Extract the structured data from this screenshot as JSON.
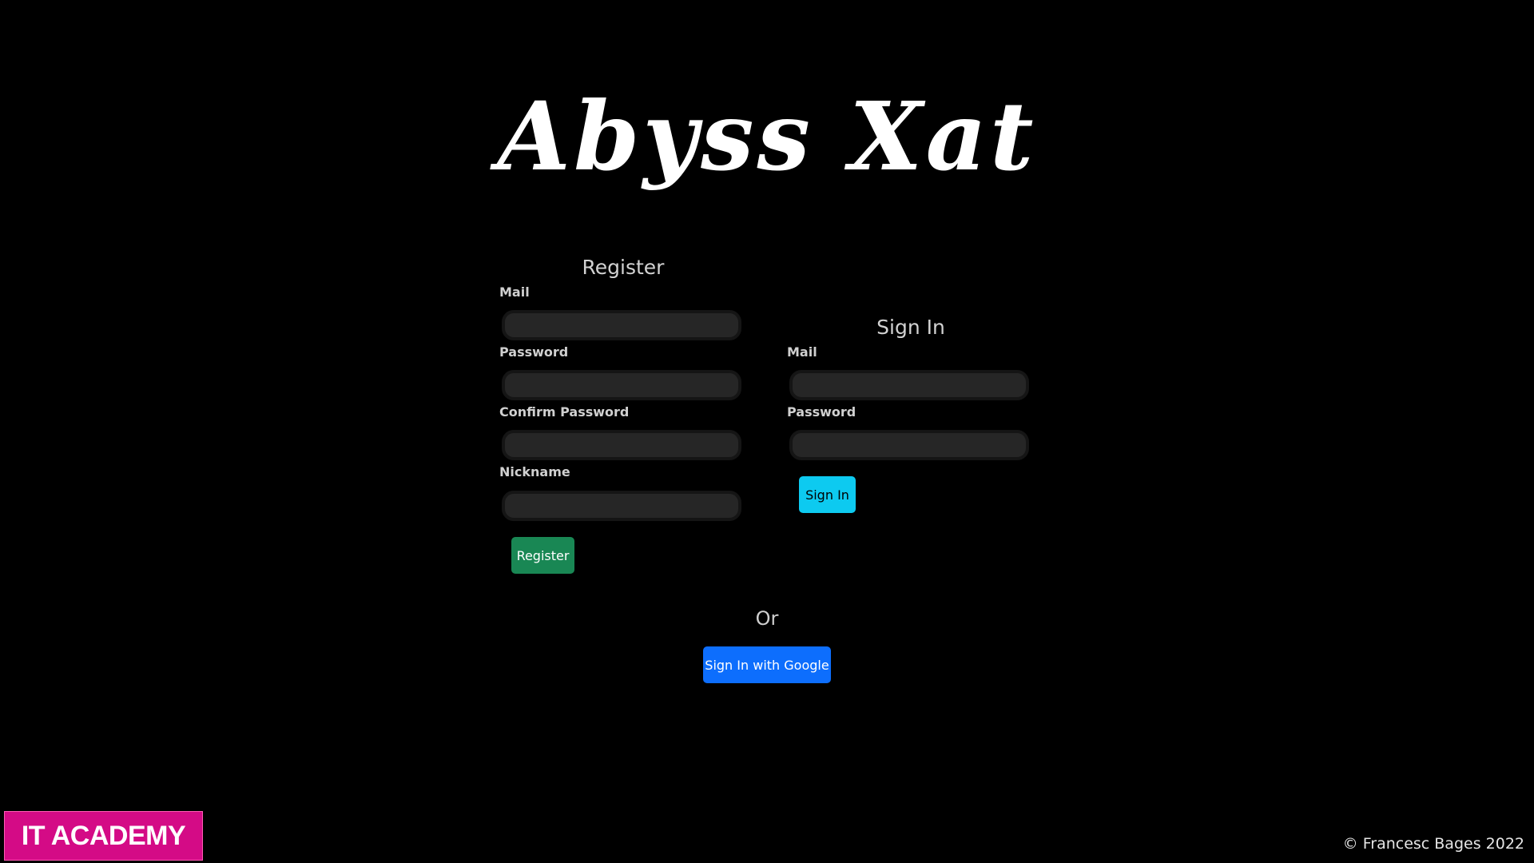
{
  "app": {
    "title": "Abyss Xat"
  },
  "register": {
    "heading": "Register",
    "mail_label": "Mail",
    "password_label": "Password",
    "confirm_password_label": "Confirm Password",
    "nickname_label": "Nickname",
    "mail_value": "",
    "password_value": "",
    "confirm_password_value": "",
    "nickname_value": "",
    "button_label": "Register",
    "button_color": "#198754"
  },
  "signin": {
    "heading": "Sign In",
    "mail_label": "Mail",
    "password_label": "Password",
    "mail_value": "",
    "password_value": "",
    "button_label": "Sign In",
    "button_color": "#0dcaf0"
  },
  "separator": {
    "text": "Or"
  },
  "google": {
    "button_label": "Sign In with Google",
    "button_color": "#0d6efd"
  },
  "footer": {
    "logo_text": "IT ACADEMY",
    "logo_color": "#d40b86",
    "copyright": "© Francesc Bages 2022"
  },
  "theme": {
    "background": "#000000",
    "input_background": "#262626"
  }
}
